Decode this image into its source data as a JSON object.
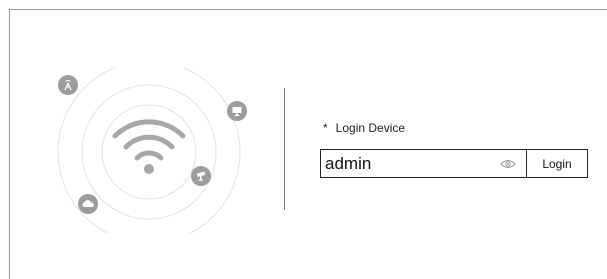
{
  "login": {
    "required_mark": "*",
    "label": "Login Device",
    "password_value": "admin",
    "button_label": "Login"
  },
  "illustration": {
    "center_icon": "wifi-icon",
    "satellite_icons": [
      "antenna-tower-icon",
      "monitor-icon",
      "camera-icon",
      "cloud-icon"
    ],
    "icon_color": "#9c9c9c"
  }
}
